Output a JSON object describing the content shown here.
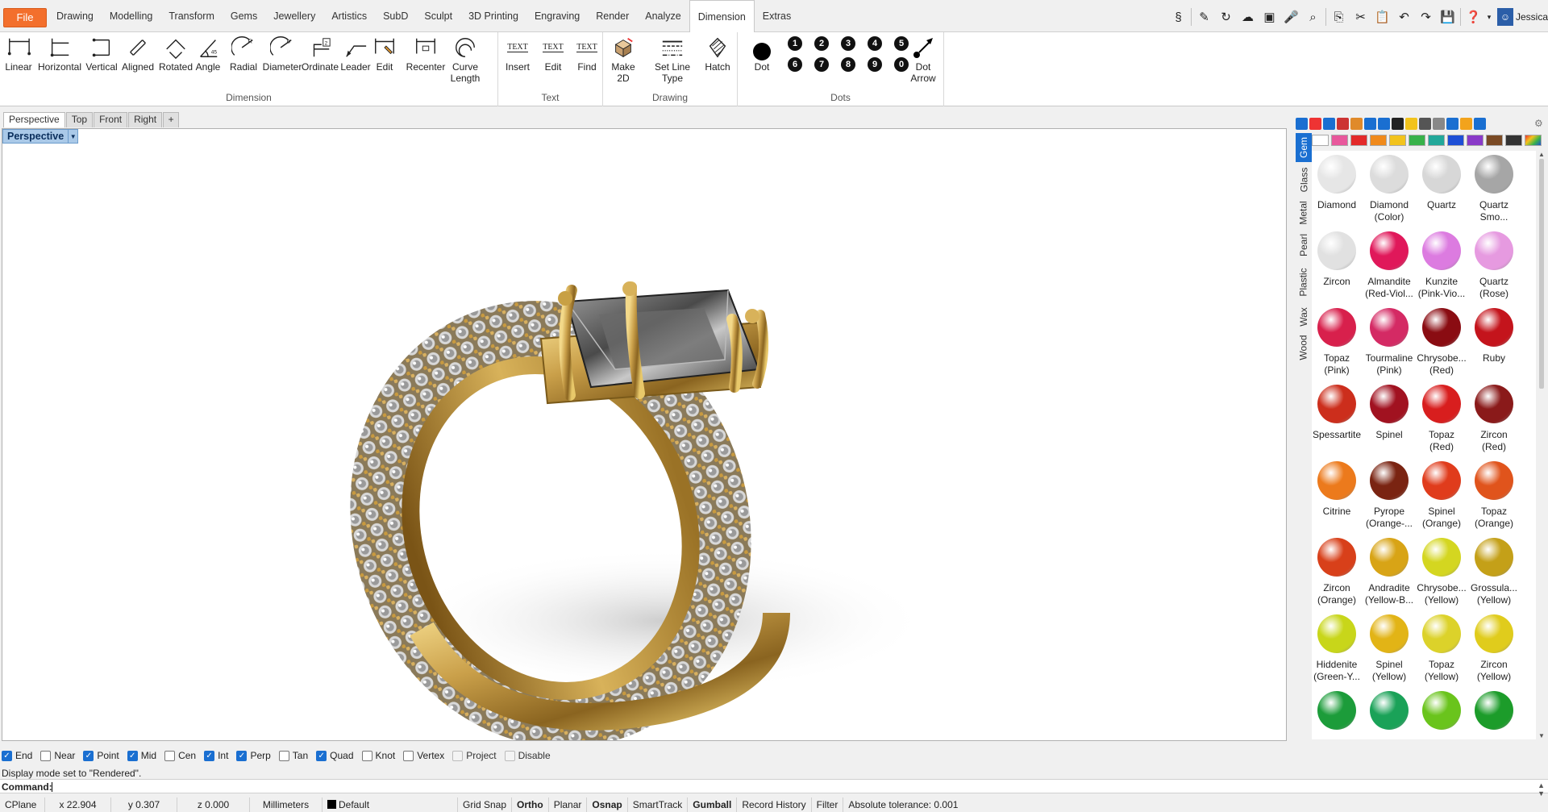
{
  "menubar": {
    "file": "File",
    "tabs": [
      "Drawing",
      "Modelling",
      "Transform",
      "Gems",
      "Jewellery",
      "Artistics",
      "SubD",
      "Sculpt",
      "3D Printing",
      "Engraving",
      "Render",
      "Analyze",
      "Dimension",
      "Extras"
    ],
    "active_tab": "Dimension",
    "user": "Jessica",
    "icons": [
      "snake-icon",
      "pencil-icon",
      "transform-icon",
      "cloud-icon",
      "clapper-icon",
      "microphone-icon",
      "zoom-icon",
      "copy-icon",
      "cut-icon",
      "paste-icon",
      "undo-icon",
      "redo-icon",
      "save-icon",
      "help-icon"
    ]
  },
  "ribbon": {
    "dimension": {
      "label": "Dimension",
      "buttons": [
        "Linear",
        "Horizontal",
        "Vertical",
        "Aligned",
        "Rotated",
        "Angle",
        "Radial",
        "Diameter",
        "Ordinate",
        "Leader",
        "Edit",
        "Recenter",
        "Curve\nLength"
      ]
    },
    "text": {
      "label": "Text",
      "buttons": [
        "Insert",
        "Edit",
        "Find"
      ],
      "icon_text": "TEXT"
    },
    "drawing": {
      "label": "Drawing",
      "buttons": [
        "Make\n2D",
        "Set Line Type",
        "Hatch"
      ]
    },
    "dots": {
      "label": "Dots",
      "dot": "Dot",
      "dot_arrow": "Dot\nArrow",
      "digits_top": [
        "1",
        "2",
        "3",
        "4",
        "5"
      ],
      "digits_bottom": [
        "6",
        "7",
        "8",
        "9",
        "0"
      ]
    }
  },
  "viewport_tabs": [
    "Perspective",
    "Top",
    "Front",
    "Right"
  ],
  "viewport_add": "+",
  "viewport": {
    "title": "Perspective"
  },
  "panel": {
    "vertical_tabs": [
      "Gem",
      "Glass",
      "Metal",
      "Pearl",
      "Plastic",
      "Wax",
      "Wood"
    ],
    "active_tab": "Gem",
    "swatch_colors": [
      "#ffffff",
      "#e8589c",
      "#e32a2a",
      "#f08a1c",
      "#f2c31c",
      "#38b24a",
      "#22a89a",
      "#1e4fd6",
      "#8a3ac8",
      "#7a4a24",
      "#333333"
    ],
    "gems": [
      {
        "label": "Diamond",
        "color": "#e6e6e6"
      },
      {
        "label": "Diamond\n(Color)",
        "color": "#dcdcdc"
      },
      {
        "label": "Quartz",
        "color": "#d7d7d7"
      },
      {
        "label": "Quartz\nSmo...",
        "color": "#a6a6a6"
      },
      {
        "label": "Zircon",
        "color": "#e1e1e1"
      },
      {
        "label": "Almandite\n(Red-Viol...",
        "color": "#e0185a"
      },
      {
        "label": "Kunzite\n(Pink-Vio...",
        "color": "#dc7be0"
      },
      {
        "label": "Quartz\n(Rose)",
        "color": "#e69ae0"
      },
      {
        "label": "Topaz\n(Pink)",
        "color": "#d8204c"
      },
      {
        "label": "Tourmaline\n(Pink)",
        "color": "#d42a64"
      },
      {
        "label": "Chrysobe...\n(Red)",
        "color": "#8a0c12"
      },
      {
        "label": "Ruby",
        "color": "#c4141c"
      },
      {
        "label": "Spessartite",
        "color": "#cc2e1c"
      },
      {
        "label": "Spinel",
        "color": "#a11220"
      },
      {
        "label": "Topaz (Red)",
        "color": "#d81e1e"
      },
      {
        "label": "Zircon\n(Red)",
        "color": "#8a1a1a"
      },
      {
        "label": "Citrine",
        "color": "#ec7a1c"
      },
      {
        "label": "Pyrope\n(Orange-...",
        "color": "#7a2412"
      },
      {
        "label": "Spinel\n(Orange)",
        "color": "#e03c1c"
      },
      {
        "label": "Topaz\n(Orange)",
        "color": "#e0541c"
      },
      {
        "label": "Zircon\n(Orange)",
        "color": "#d8401a"
      },
      {
        "label": "Andradite\n(Yellow-B...",
        "color": "#d8a416"
      },
      {
        "label": "Chrysobe...\n(Yellow)",
        "color": "#d4d620"
      },
      {
        "label": "Grossula...\n(Yellow)",
        "color": "#c4a018"
      },
      {
        "label": "Hiddenite\n(Green-Y...",
        "color": "#c8d61a"
      },
      {
        "label": "Spinel\n(Yellow)",
        "color": "#e2b416"
      },
      {
        "label": "Topaz\n(Yellow)",
        "color": "#dcd22a"
      },
      {
        "label": "Zircon\n(Yellow)",
        "color": "#e0cc1c"
      },
      {
        "label": "",
        "color": "#1c9c3a"
      },
      {
        "label": "",
        "color": "#1aa258"
      },
      {
        "label": "",
        "color": "#6ac41c"
      },
      {
        "label": "",
        "color": "#1c9c2a"
      }
    ]
  },
  "osnap": [
    {
      "label": "End",
      "checked": true
    },
    {
      "label": "Near",
      "checked": false
    },
    {
      "label": "Point",
      "checked": true
    },
    {
      "label": "Mid",
      "checked": true
    },
    {
      "label": "Cen",
      "checked": false
    },
    {
      "label": "Int",
      "checked": true
    },
    {
      "label": "Perp",
      "checked": true
    },
    {
      "label": "Tan",
      "checked": false
    },
    {
      "label": "Quad",
      "checked": true
    },
    {
      "label": "Knot",
      "checked": false
    },
    {
      "label": "Vertex",
      "checked": false
    },
    {
      "label": "Project",
      "checked": false,
      "disabled": true
    },
    {
      "label": "Disable",
      "checked": false,
      "disabled": true
    }
  ],
  "command": {
    "history": "Display mode set to \"Rendered\".",
    "prompt": "Command:"
  },
  "status": {
    "cplane": "CPlane",
    "x": "x 22.904",
    "y": "y 0.307",
    "z": "z 0.000",
    "units": "Millimeters",
    "layer": "Default",
    "toggles": [
      "Grid Snap",
      "Ortho",
      "Planar",
      "Osnap",
      "SmartTrack",
      "Gumball",
      "Record History",
      "Filter"
    ],
    "bold_toggles": [
      "Ortho",
      "Osnap",
      "Gumball"
    ],
    "tolerance": "Absolute tolerance: 0.001"
  }
}
